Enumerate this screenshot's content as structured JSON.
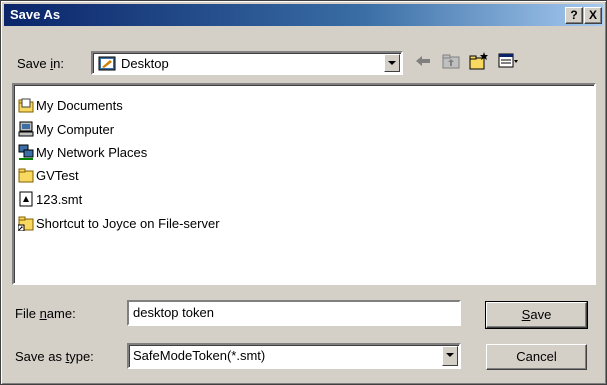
{
  "window": {
    "title": "Save As",
    "help_label": "?",
    "close_label": "X"
  },
  "save_in": {
    "label_pre": "Save ",
    "label_key": "i",
    "label_post": "n:",
    "value": "Desktop"
  },
  "files": [
    {
      "name": "My Documents",
      "icon": "my-documents-icon"
    },
    {
      "name": "My Computer",
      "icon": "my-computer-icon"
    },
    {
      "name": "My Network Places",
      "icon": "network-places-icon"
    },
    {
      "name": "GVTest",
      "icon": "folder-icon"
    },
    {
      "name": "123.smt",
      "icon": "file-icon"
    },
    {
      "name": "Shortcut to Joyce on File-server",
      "icon": "shortcut-folder-icon"
    }
  ],
  "file_name": {
    "label_pre": "File ",
    "label_key": "n",
    "label_post": "ame:",
    "value": "desktop token"
  },
  "save_type": {
    "label_pre": "Save as ",
    "label_key": "t",
    "label_post": "ype:",
    "value": "SafeModeToken(*.smt)"
  },
  "buttons": {
    "save_key": "S",
    "save_rest": "ave",
    "cancel": "Cancel"
  }
}
